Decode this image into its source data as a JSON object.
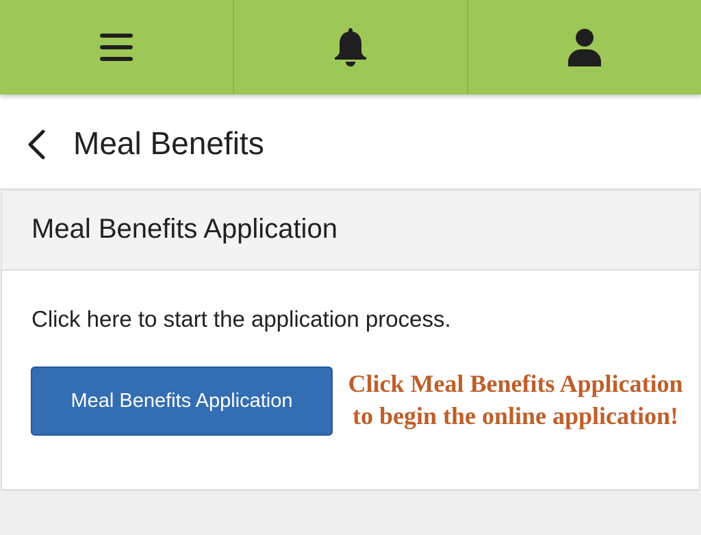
{
  "topbar": {
    "background": "#9dc756",
    "icons": [
      "hamburger-menu-icon",
      "bell-icon",
      "user-icon"
    ]
  },
  "header": {
    "title": "Meal Benefits",
    "back_icon": "chevron-left-icon"
  },
  "card": {
    "title": "Meal Benefits Application",
    "description": "Click here to start the application process.",
    "button_label": "Meal Benefits Application",
    "button_color": "#336db3"
  },
  "annotation": {
    "line1": "Click Meal Benefits Application",
    "line2": "to begin the online application!",
    "color": "#bf5f2a"
  }
}
